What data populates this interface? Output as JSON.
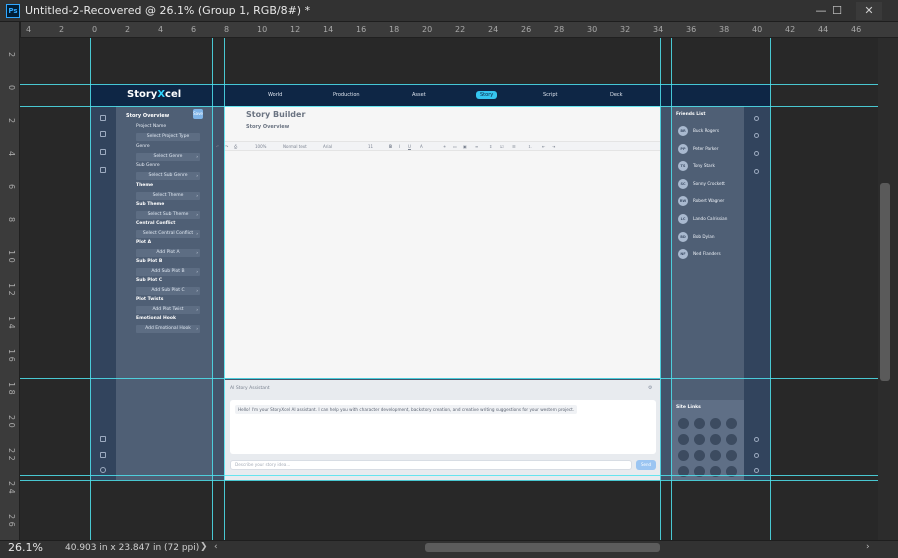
{
  "window": {
    "app_icon": "Ps",
    "title": "Untitled-2-Recovered @ 26.1% (Group 1, RGB/8#) *",
    "minimize": "—",
    "maximize": "☐",
    "close": "✕"
  },
  "rulers": {
    "horizontal": [
      "4",
      "2",
      "0",
      "2",
      "4",
      "6",
      "8",
      "10",
      "12",
      "14",
      "16",
      "18",
      "20",
      "22",
      "24",
      "26",
      "28",
      "30",
      "32",
      "34",
      "36",
      "38",
      "40",
      "42",
      "44",
      "46"
    ],
    "vertical": [
      "2",
      "0",
      "2",
      "4",
      "6",
      "8",
      "1 0",
      "1 2",
      "1 4",
      "1 6",
      "1 8",
      "2 0",
      "2 2",
      "2 4",
      "2 6"
    ]
  },
  "status": {
    "zoom": "26.1%",
    "dimensions": "40.903 in x 23.847 in (72 ppi)",
    "more": "❯"
  },
  "app": {
    "logo_prefix": "Story",
    "logo_x": "X",
    "logo_suffix": "cel",
    "nav": [
      "World",
      "Production",
      "Asset",
      "Story",
      "Script",
      "Deck"
    ],
    "active_nav": "Story",
    "left_panel": {
      "title": "Story Overview",
      "save_label": "Save",
      "fields": [
        {
          "label": "Project Name",
          "placeholder": "Select Project Type"
        },
        {
          "label": "Genre",
          "placeholder": "Select Genre"
        },
        {
          "label": "Sub Genre",
          "placeholder": "Select Sub Genre"
        },
        {
          "label": "Theme",
          "placeholder": "Select Theme"
        },
        {
          "label": "Sub Theme",
          "placeholder": "Select Sub Theme"
        },
        {
          "label": "Central Conflict",
          "placeholder": "Select Central Conflict"
        },
        {
          "label": "Plot A",
          "placeholder": "Add Plot A"
        },
        {
          "label": "Sub Plot B",
          "placeholder": "Add Sub Plot B"
        },
        {
          "label": "Sub Plot C",
          "placeholder": "Add Sub Plot C"
        },
        {
          "label": "Plot Twists",
          "placeholder": "Add Plot Twist"
        },
        {
          "label": "Emotional Hook",
          "placeholder": "Add Emotional Hook"
        }
      ]
    },
    "editor": {
      "title": "Story Builder",
      "subtitle": "Story Overview",
      "toolbar": {
        "zoom": "100%",
        "style": "Normal text",
        "font": "Arial",
        "size": "11"
      }
    },
    "assistant": {
      "title": "AI Story Assistant",
      "message": "Hello! I'm your StoryXcel AI assistant. I can help you with character development, backstory creation, and creative writing suggestions for your western project.",
      "input_placeholder": "Describe your story idea...",
      "send": "Send"
    },
    "right_panel": {
      "title": "Friends List",
      "friends": [
        {
          "initials": "BR",
          "name": "Buck Rogers"
        },
        {
          "initials": "PP",
          "name": "Peter Parker"
        },
        {
          "initials": "TS",
          "name": "Tony Stark"
        },
        {
          "initials": "SC",
          "name": "Sonny Crockett"
        },
        {
          "initials": "RW",
          "name": "Robert Wagner"
        },
        {
          "initials": "LC",
          "name": "Lando Calrissian"
        },
        {
          "initials": "BD",
          "name": "Bob Dylan"
        },
        {
          "initials": "NF",
          "name": "Ned Flanders"
        }
      ],
      "site_links_title": "Site Links"
    }
  }
}
